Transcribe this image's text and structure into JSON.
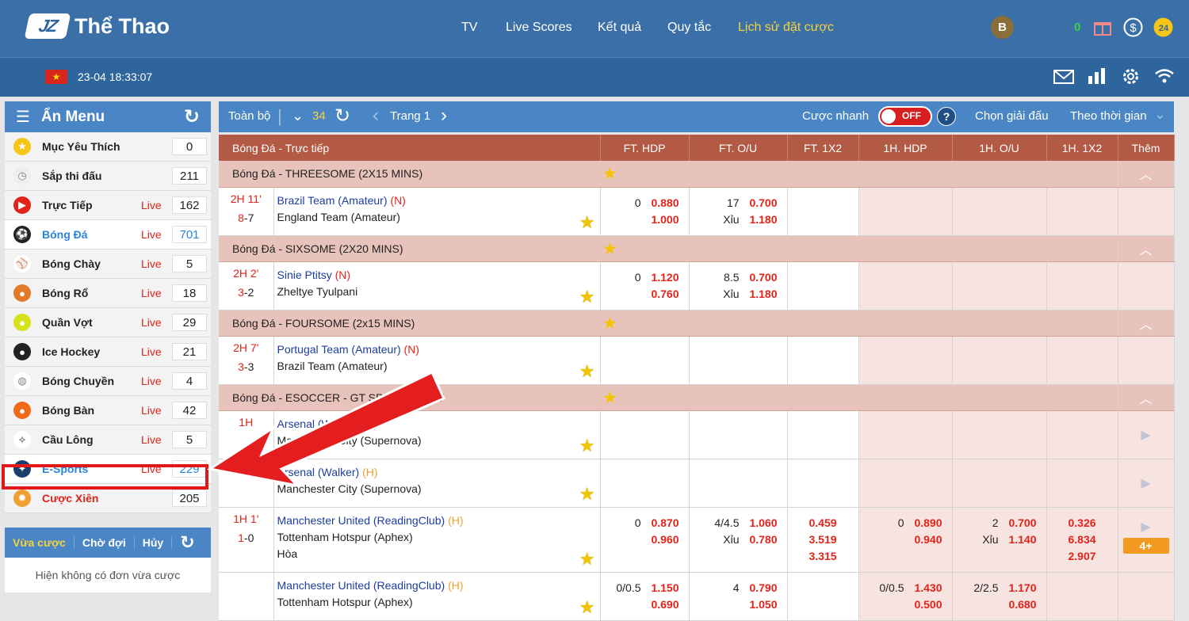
{
  "header": {
    "logo_text": "JZ",
    "title": "Thể Thao",
    "nav": [
      "TV",
      "Live Scores",
      "Kết quả",
      "Quy tắc",
      "Lịch sử đặt cược"
    ],
    "avatar": "B",
    "balance": "0",
    "badge24": "24"
  },
  "subheader": {
    "datetime": "23-04 18:33:07"
  },
  "sidebar": {
    "title": "Ẩn Menu",
    "items": [
      {
        "name": "Mục Yêu Thích",
        "live": "",
        "count": "0",
        "icon": "star-icon"
      },
      {
        "name": "Sắp thi đấu",
        "live": "",
        "count": "211",
        "icon": "stopwatch-icon"
      },
      {
        "name": "Trực Tiếp",
        "live": "Live",
        "count": "162",
        "icon": "play-circle-icon"
      },
      {
        "name": "Bóng Đá",
        "live": "Live",
        "count": "701",
        "icon": "soccer-ball-icon"
      },
      {
        "name": "Bóng Chày",
        "live": "Live",
        "count": "5",
        "icon": "baseball-icon"
      },
      {
        "name": "Bóng Rổ",
        "live": "Live",
        "count": "18",
        "icon": "basketball-icon"
      },
      {
        "name": "Quần Vợt",
        "live": "Live",
        "count": "29",
        "icon": "tennis-ball-icon"
      },
      {
        "name": "Ice Hockey",
        "live": "Live",
        "count": "21",
        "icon": "hockey-puck-icon"
      },
      {
        "name": "Bóng Chuyền",
        "live": "Live",
        "count": "4",
        "icon": "volleyball-icon"
      },
      {
        "name": "Bóng Bàn",
        "live": "Live",
        "count": "42",
        "icon": "ping-pong-icon"
      },
      {
        "name": "Cầu Lông",
        "live": "Live",
        "count": "5",
        "icon": "shuttlecock-icon"
      },
      {
        "name": "E-Sports",
        "live": "Live",
        "count": "229",
        "icon": "gamepad-icon"
      },
      {
        "name": "Cược Xiên",
        "live": "",
        "count": "205",
        "icon": "parlay-icon"
      }
    ],
    "bet_tabs": [
      "Vừa cược",
      "Chờ đợi",
      "Hủy"
    ],
    "empty_text": "Hiện không có đơn vừa cược"
  },
  "toolbar": {
    "all": "Toàn bộ",
    "count": "34",
    "page": "Trang 1",
    "quick_bet": "Cược nhanh",
    "toggle": "OFF",
    "help": "?",
    "choose_league": "Chọn giải đấu",
    "by_time": "Theo thời gian"
  },
  "table": {
    "headers": [
      "Bóng Đá - Trực tiếp",
      "FT. HDP",
      "FT. O/U",
      "FT. 1X2",
      "1H. HDP",
      "1H. O/U",
      "1H. 1X2",
      "Thêm"
    ],
    "leagues": [
      "Bóng Đá - THREESOME (2X15 MINS)",
      "Bóng Đá - SIXSOME (2X20 MINS)",
      "Bóng Đá - FOURSOME (2x15 MINS)",
      "Bóng Đá - ESOCCER - GT SPORTS PLAY"
    ],
    "matches": [
      {
        "time": "2H 11'",
        "score_a": "8",
        "score_b": "7",
        "home": "Brazil Team (Amateur)",
        "home_tag": "(N)",
        "away": "England Team (Amateur)",
        "ft_hdp": {
          "h": "0",
          "o1": "0.880",
          "o2": "1.000"
        },
        "ft_ou": {
          "h": "17",
          "o1": "0.700",
          "x": "Xỉu",
          "o2": "1.180"
        }
      },
      {
        "time": "2H 2'",
        "score_a": "3",
        "score_b": "2",
        "home": "Sinie Ptitsy",
        "home_tag": "(N)",
        "away": "Zheltye Tyulpani",
        "ft_hdp": {
          "h": "0",
          "o1": "1.120",
          "o2": "0.760"
        },
        "ft_ou": {
          "h": "8.5",
          "o1": "0.700",
          "x": "Xỉu",
          "o2": "1.180"
        }
      },
      {
        "time": "2H 7'",
        "score_a": "3",
        "score_b": "3",
        "home": "Portugal Team  (Amateur)",
        "home_tag": "(N)",
        "away": "Brazil Team  (Amateur)"
      },
      {
        "time": "1H",
        "home": "Arsenal (Walker)",
        "home_tag": "(H)",
        "away": "Manchester City (Supernova)"
      },
      {
        "home": "Arsenal (Walker)",
        "home_tag": "(H)",
        "away": "Manchester City (Supernova)"
      },
      {
        "time": "1H 1'",
        "score_a": "1",
        "score_b": "0",
        "home": "Manchester United (ReadingClub)",
        "home_tag": "(H)",
        "away": "Tottenham Hotspur (Aphex)",
        "draw": "Hòa",
        "ft_hdp": {
          "h": "0",
          "o1": "0.870",
          "o2": "0.960"
        },
        "ft_ou": {
          "h": "4/4.5",
          "o1": "1.060",
          "x": "Xỉu",
          "o2": "0.780"
        },
        "ft_1x2": [
          "0.459",
          "3.519",
          "3.315"
        ],
        "h1_hdp": {
          "h": "0",
          "o1": "0.890",
          "o2": "0.940"
        },
        "h1_ou": {
          "h": "2",
          "o1": "0.700",
          "x": "Xỉu",
          "o2": "1.140"
        },
        "h1_1x2": [
          "0.326",
          "6.834",
          "2.907"
        ],
        "more": "4+"
      },
      {
        "home": "Manchester United (ReadingClub)",
        "home_tag": "(H)",
        "away": "Tottenham Hotspur (Aphex)",
        "ft_hdp": {
          "h": "0/0.5",
          "o1": "1.150",
          "o2": "0.690"
        },
        "ft_ou": {
          "h": "4",
          "o1": "0.790",
          "o2": "1.050"
        },
        "h1_hdp": {
          "h": "0/0.5",
          "o1": "1.430",
          "o2": "0.500"
        },
        "h1_ou": {
          "h": "2/2.5",
          "o1": "1.170",
          "o2": "0.680"
        }
      }
    ]
  },
  "colors": {
    "header_blue": "#3a6fa8",
    "accent_yellow": "#f5d23e",
    "table_header": "#b25a44",
    "league_row": "#e8c3bb",
    "odds_red": "#e2231a",
    "highlight_red": "#e01818"
  }
}
